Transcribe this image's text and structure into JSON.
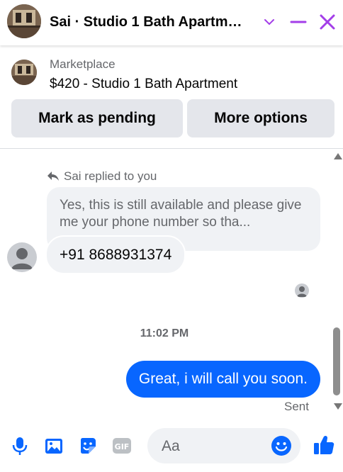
{
  "header": {
    "title": "Sai · Studio 1 Bath Apartm…",
    "icons": [
      "chevron-down-icon",
      "minimize-icon",
      "close-icon"
    ],
    "accent_color": "#a33ee8"
  },
  "listing": {
    "subtitle": "Marketplace",
    "title": "$420 - Studio 1 Bath Apartment",
    "buttons": {
      "pending": "Mark as pending",
      "more": "More options"
    }
  },
  "chat": {
    "reply_note": "Sai replied to you",
    "quoted_text": "Yes, this is still available and please give me your phone number so tha...",
    "received_message": "+91 8688931374",
    "timestamp": "11:02 PM",
    "sent_message": "Great, i will call you soon.",
    "sent_status": "Sent",
    "sent_bubble_color": "#0866ff"
  },
  "composer": {
    "placeholder": "Aa",
    "tools": [
      "microphone-icon",
      "photo-icon",
      "sticker-icon",
      "gif-icon"
    ],
    "send_icon": "like-icon",
    "tool_color": "#0866ff"
  }
}
